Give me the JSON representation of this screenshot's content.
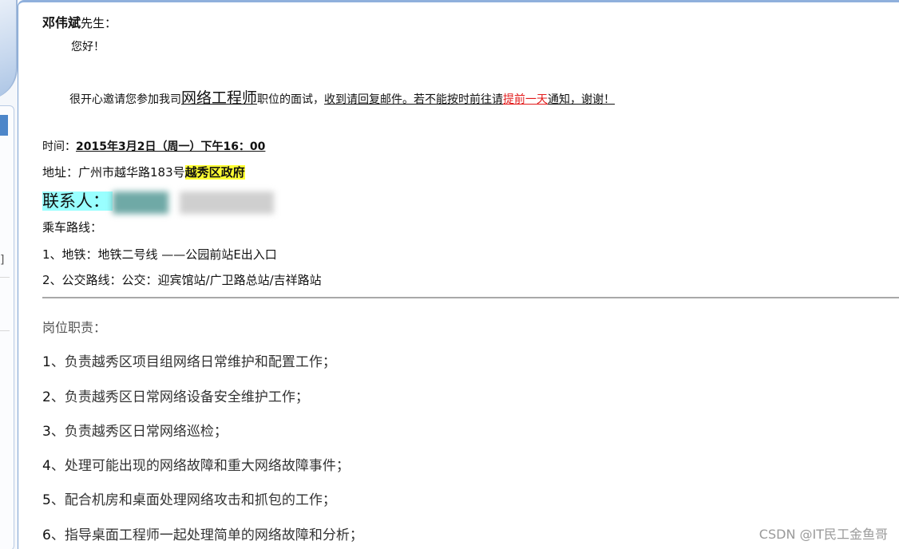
{
  "letter": {
    "recipient_name": "邓伟斌",
    "recipient_title": "先生：",
    "greeting": "您好！",
    "invite_prefix": "很开心邀请您参加我司",
    "position": "网络工程师",
    "invite_mid": "职位的面试，",
    "invite_reply": "收到请回复邮件。若不能按时前往请",
    "invite_red": "提前一天",
    "invite_end": "通知，谢谢！",
    "time_label": "时间：",
    "time_value": "2015年3月2日（周一）下午16：00",
    "address_label": "地址：",
    "address_value": "广州市越华路183号",
    "address_highlight": "越秀区政府",
    "contact_label": "联系人：",
    "route_title": "乘车路线：",
    "route_1": "1、地铁：地铁二号线 ——公园前站E出入口",
    "route_2": "2、公交路线：公交：迎宾馆站/广卫路总站/吉祥路站"
  },
  "duties": {
    "title": "岗位职责：",
    "items": [
      {
        "num": "1",
        "text": "、负责越秀区项目组网络日常维护和配置工作；"
      },
      {
        "num": "2",
        "text": "、负责越秀区日常网络设备安全维护工作；"
      },
      {
        "num": "3",
        "text": "、负责越秀区日常网络巡检；"
      },
      {
        "num": "4",
        "text": "、处理可能出现的网络故障和重大网络故障事件；"
      },
      {
        "num": "5",
        "text": "、配合机房和桌面处理网络攻击和抓包的工作；"
      },
      {
        "num": "6",
        "text": "、指导桌面工程师一起处理简单的网络故障和分析；"
      }
    ]
  },
  "sidebar": {
    "bracket_text": "]"
  },
  "watermark": "CSDN @IT民工金鱼哥",
  "colors": {
    "accent_blue": "#4d86c9",
    "highlight_yellow": "#ffff33",
    "highlight_cyan": "#99ffff",
    "emphasis_red": "#e21b1b"
  }
}
